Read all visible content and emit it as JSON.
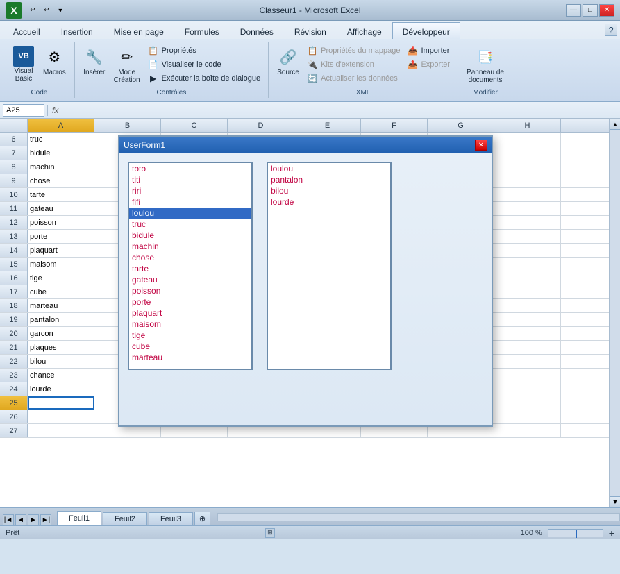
{
  "window": {
    "title": "Classeur1 - Microsoft Excel"
  },
  "titlebar": {
    "quickaccess": [
      "↩",
      "↩",
      "▼"
    ],
    "controls": [
      "—",
      "□",
      "✕"
    ]
  },
  "ribbon": {
    "tabs": [
      "Accueil",
      "Insertion",
      "Mise en page",
      "Formules",
      "Données",
      "Révision",
      "Affichage",
      "Développeur"
    ],
    "active_tab": "Développeur",
    "groups": {
      "code": {
        "label": "Code",
        "items": [
          {
            "label": "Visual\nBasic",
            "icon": "📊"
          },
          {
            "label": "Macros",
            "icon": "⚙"
          }
        ]
      },
      "controles": {
        "label": "Contrôles",
        "items": [
          {
            "label": "Insérer",
            "icon": "🔧"
          },
          {
            "label": "Mode\nCréation",
            "icon": "✏"
          },
          {
            "label": "Propriétés",
            "icon": "📋"
          },
          {
            "label": "Visualiser le code",
            "icon": "📄"
          },
          {
            "label": "Exécuter la boîte de dialogue",
            "icon": "▶"
          }
        ]
      },
      "xml": {
        "label": "XML",
        "items": [
          {
            "label": "Source",
            "icon": "🔗"
          },
          {
            "label": "Propriétés du mappage",
            "icon": "📋"
          },
          {
            "label": "Kits d'extension",
            "icon": "🔌"
          },
          {
            "label": "Actualiser les données",
            "icon": "🔄"
          },
          {
            "label": "Importer",
            "icon": "📥"
          },
          {
            "label": "Exporter",
            "icon": "📤"
          }
        ]
      },
      "modifier": {
        "label": "Modifier",
        "items": [
          {
            "label": "Panneau de\ndocuments",
            "icon": "📑"
          }
        ]
      }
    }
  },
  "formulabar": {
    "cell_ref": "A25",
    "formula": ""
  },
  "spreadsheet": {
    "col_headers": [
      "A",
      "B",
      "C",
      "D",
      "E",
      "F",
      "G",
      "H"
    ],
    "active_col": "A",
    "rows": [
      {
        "num": 6,
        "cells": [
          "truc",
          "",
          "",
          "",
          "",
          "",
          "",
          ""
        ]
      },
      {
        "num": 7,
        "cells": [
          "bidule",
          "",
          "",
          "",
          "",
          "",
          "",
          ""
        ]
      },
      {
        "num": 8,
        "cells": [
          "machin",
          "",
          "",
          "",
          "",
          "",
          "",
          ""
        ]
      },
      {
        "num": 9,
        "cells": [
          "chose",
          "",
          "",
          "",
          "",
          "",
          "",
          ""
        ]
      },
      {
        "num": 10,
        "cells": [
          "tarte",
          "",
          "",
          "",
          "",
          "",
          "",
          ""
        ]
      },
      {
        "num": 11,
        "cells": [
          "gateau",
          "",
          "",
          "",
          "",
          "",
          "",
          ""
        ]
      },
      {
        "num": 12,
        "cells": [
          "poisson",
          "",
          "",
          "",
          "",
          "",
          "",
          ""
        ]
      },
      {
        "num": 13,
        "cells": [
          "porte",
          "",
          "",
          "",
          "",
          "",
          "",
          ""
        ]
      },
      {
        "num": 14,
        "cells": [
          "plaquart",
          "",
          "",
          "",
          "",
          "",
          "",
          ""
        ]
      },
      {
        "num": 15,
        "cells": [
          "maisom",
          "",
          "",
          "",
          "",
          "",
          "",
          ""
        ]
      },
      {
        "num": 16,
        "cells": [
          "tige",
          "",
          "",
          "",
          "",
          "",
          "",
          ""
        ]
      },
      {
        "num": 17,
        "cells": [
          "cube",
          "",
          "",
          "",
          "",
          "",
          "",
          ""
        ]
      },
      {
        "num": 18,
        "cells": [
          "marteau",
          "",
          "",
          "",
          "",
          "",
          "",
          ""
        ]
      },
      {
        "num": 19,
        "cells": [
          "pantalon",
          "",
          "",
          "",
          "",
          "",
          "",
          ""
        ]
      },
      {
        "num": 20,
        "cells": [
          "garcon",
          "",
          "",
          "",
          "",
          "",
          "",
          ""
        ]
      },
      {
        "num": 21,
        "cells": [
          "plaques",
          "",
          "",
          "",
          "",
          "",
          "",
          ""
        ]
      },
      {
        "num": 22,
        "cells": [
          "bilou",
          "",
          "",
          "",
          "",
          "",
          "",
          ""
        ]
      },
      {
        "num": 23,
        "cells": [
          "chance",
          "",
          "",
          "",
          "",
          "",
          "",
          ""
        ]
      },
      {
        "num": 24,
        "cells": [
          "lourde",
          "",
          "",
          "",
          "",
          "",
          "",
          ""
        ]
      },
      {
        "num": 25,
        "cells": [
          "",
          "",
          "",
          "",
          "",
          "",
          "",
          ""
        ]
      },
      {
        "num": 26,
        "cells": [
          "",
          "",
          "",
          "",
          "",
          "",
          "",
          ""
        ]
      },
      {
        "num": 27,
        "cells": [
          "",
          "",
          "",
          "",
          "",
          "",
          "",
          ""
        ]
      }
    ],
    "active_row": 25
  },
  "userform": {
    "title": "UserForm1",
    "listbox1_items": [
      "toto",
      "titi",
      "riri",
      "fifi",
      "loulou",
      "truc",
      "bidule",
      "machin",
      "chose",
      "tarte",
      "gateau",
      "poisson",
      "porte",
      "plaquart",
      "maisom",
      "tige",
      "cube",
      "marteau"
    ],
    "listbox1_selected": "loulou",
    "listbox2_items": [
      "loulou",
      "pantalon",
      "bilou",
      "lourde"
    ]
  },
  "sheet_tabs": [
    "Feuil1",
    "Feuil2",
    "Feuil3"
  ],
  "active_sheet": "Feuil1",
  "status": {
    "left": "Prêt",
    "zoom": "100 %"
  }
}
